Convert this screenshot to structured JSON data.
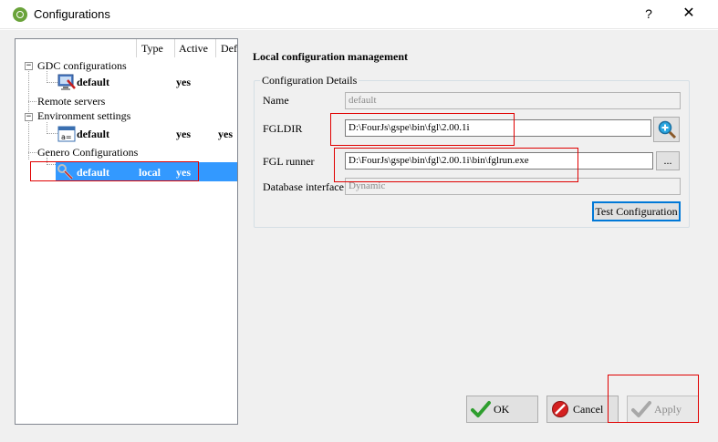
{
  "window": {
    "title": "Configurations",
    "help": "?",
    "close": "✕"
  },
  "tree": {
    "columns": [
      "Type",
      "Active",
      "Def"
    ],
    "nodes": {
      "gdc": {
        "label": "GDC configurations",
        "child": {
          "name": "default",
          "type": "",
          "active": "yes",
          "def": ""
        }
      },
      "remote": {
        "label": "Remote servers"
      },
      "env": {
        "label": "Environment settings",
        "child": {
          "name": "default",
          "type": "",
          "active": "yes",
          "def": "yes"
        }
      },
      "genero": {
        "label": "Genero Configurations",
        "child": {
          "name": "default",
          "type": "local",
          "active": "yes",
          "def": ""
        }
      }
    }
  },
  "panel": {
    "title": "Local configuration management",
    "group_title": "Configuration Details",
    "name_label": "Name",
    "name_value": "default",
    "fgldir_label": "FGLDIR",
    "fgldir_value": "D:\\FourJs\\gspe\\bin\\fgl\\2.00.1i",
    "runner_label": "FGL runner",
    "runner_value": "D:\\FourJs\\gspe\\bin\\fgl\\2.00.1i\\bin\\fglrun.exe",
    "browse_label": "...",
    "db_label": "Database interface",
    "db_value": "Dynamic",
    "test_label": "Test Configuration"
  },
  "footer": {
    "ok": "OK",
    "cancel": "Cancel",
    "apply": "Apply"
  },
  "colors": {
    "selection": "#3399ff",
    "highlight_box": "#e00000",
    "ok_check": "#2e9e2e",
    "cancel_icon": "#d42020"
  }
}
